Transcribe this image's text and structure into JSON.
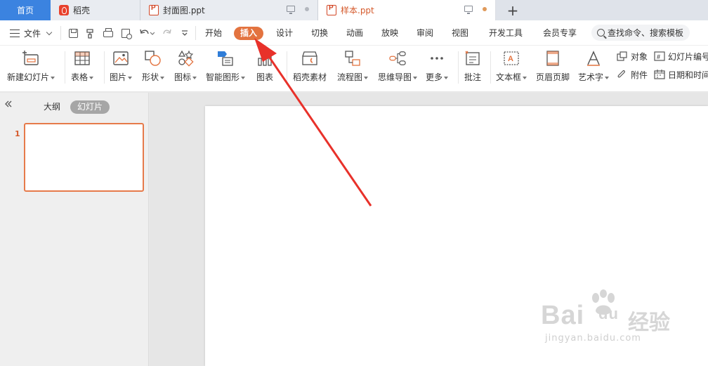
{
  "tabs": {
    "home": "首页",
    "daoke": "稻壳",
    "doc1": "封面图.ppt",
    "doc2": "样本.ppt",
    "new_tab": "+"
  },
  "menu": {
    "file": "文件",
    "tabs": [
      "开始",
      "插入",
      "设计",
      "切换",
      "动画",
      "放映",
      "审阅",
      "视图",
      "开发工具",
      "会员专享"
    ],
    "active_tab": "插入",
    "search_placeholder": "查找命令、搜索模板"
  },
  "ribbon": {
    "new_slide": "新建幻灯片",
    "table": "表格",
    "picture": "图片",
    "shape": "形状",
    "icon": "图标",
    "smartart": "智能图形",
    "chart": "图表",
    "daoke_material": "稻壳素材",
    "flowchart": "流程图",
    "mindmap": "思维导图",
    "more": "更多",
    "comment": "批注",
    "textbox": "文本框",
    "header_footer": "页眉页脚",
    "wordart": "艺术字",
    "object": "对象",
    "attachment": "附件",
    "slide_number": "幻灯片编号",
    "datetime": "日期和时间"
  },
  "left_panel": {
    "outline": "大纲",
    "slides": "幻灯片",
    "slide_index": "1"
  },
  "watermark": {
    "main": "Bai",
    "du": "du",
    "cn": "经验",
    "sub": "jingyan.baidu.com"
  },
  "colors": {
    "accent": "#e3733f",
    "home_tab": "#3b83e0",
    "arrow": "#e8312a"
  }
}
